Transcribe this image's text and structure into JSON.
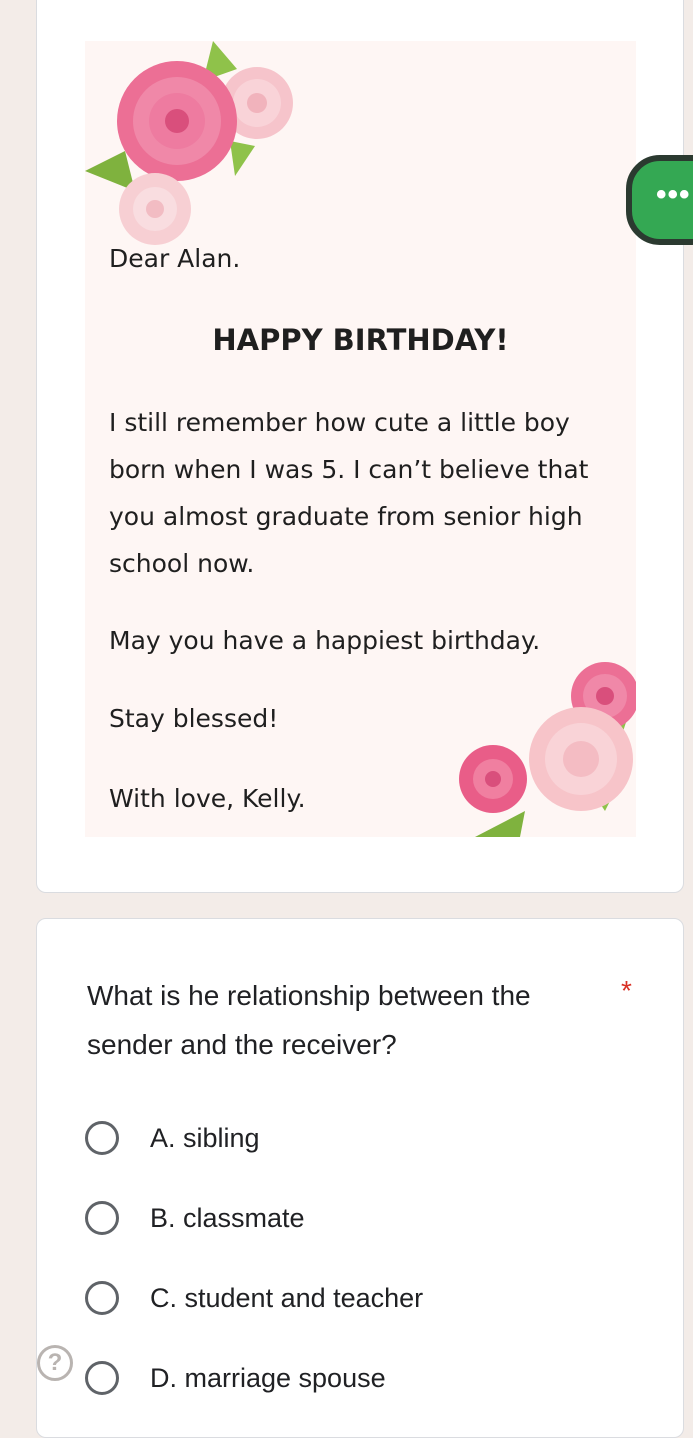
{
  "letter": {
    "greeting": "Dear Alan.",
    "headline": "HAPPY BIRTHDAY!",
    "body": "I still remember how cute a little boy born when I was 5. I can’t believe that you almost graduate from senior high school now.",
    "wish": "May you have a happiest birthday.",
    "blessing": "Stay blessed!",
    "signoff": "With love, Kelly."
  },
  "fab": {
    "icon": "more-icon",
    "glyph": "•••"
  },
  "question": {
    "text": "What is he relationship between the sender and the receiver?",
    "required_marker": "*",
    "options": [
      {
        "label": "A. sibling"
      },
      {
        "label": "B. classmate"
      },
      {
        "label": "C. student and teacher"
      },
      {
        "label": "D. marriage spouse"
      }
    ]
  },
  "help": {
    "glyph": "?"
  },
  "colors": {
    "background": "#f3ece8",
    "card": "#ffffff",
    "letter_background": "#fef6f4",
    "fab": "#34a853",
    "required": "#d93025",
    "radio_border": "#5f6368"
  }
}
